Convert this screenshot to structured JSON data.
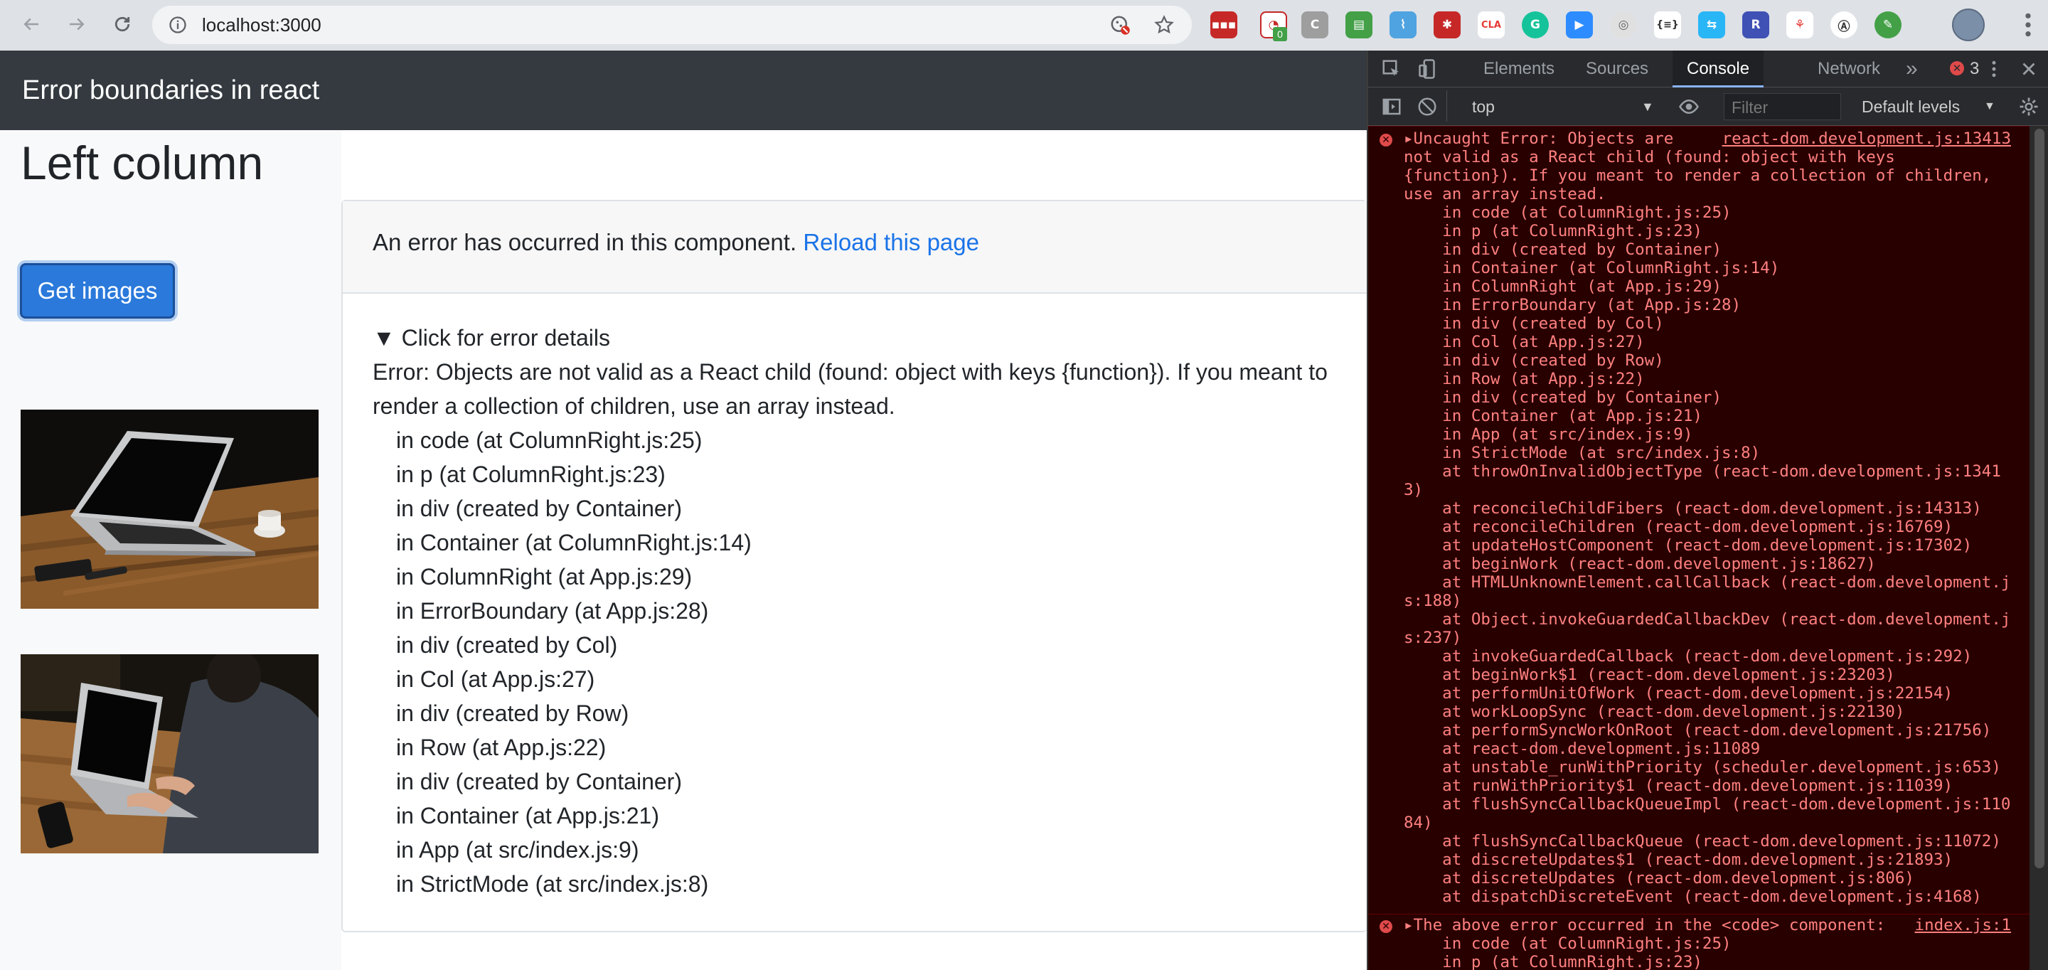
{
  "browser": {
    "url": "localhost:3000",
    "extension_badge": "0"
  },
  "app": {
    "title": "Error boundaries in react"
  },
  "left_column": {
    "heading": "Left column",
    "button_label": "Get images"
  },
  "error_card": {
    "header_text": "An error has occurred in this component.",
    "reload_link": "Reload this page",
    "summary": "▼ Click for error details",
    "error_message": "Error: Objects are not valid as a React child (found: object with keys {function}). If you meant to render a collection of children, use an array instead.",
    "stack": [
      "in code (at ColumnRight.js:25)",
      "in p (at ColumnRight.js:23)",
      "in div (created by Container)",
      "in Container (at ColumnRight.js:14)",
      "in ColumnRight (at App.js:29)",
      "in ErrorBoundary (at App.js:28)",
      "in div (created by Col)",
      "in Col (at App.js:27)",
      "in div (created by Row)",
      "in Row (at App.js:22)",
      "in div (created by Container)",
      "in Container (at App.js:21)",
      "in App (at src/index.js:9)",
      "in StrictMode (at src/index.js:8)"
    ]
  },
  "devtools": {
    "tabs": [
      "Elements",
      "Sources",
      "Console",
      "Network"
    ],
    "active_tab": "Console",
    "more_tabs": "»",
    "error_count": "3",
    "context": "top",
    "filter_placeholder": "Filter",
    "levels": "Default levels",
    "colors": {
      "error_text": "#ff8080",
      "error_bg": "#290000"
    },
    "messages": [
      {
        "source": "react-dom.development.js:13413",
        "lines": [
          "▸Uncaught Error: Objects are",
          "not valid as a React child (found: object with keys",
          "{function}). If you meant to render a collection of children,",
          "use an array instead.",
          "    in code (at ColumnRight.js:25)",
          "    in p (at ColumnRight.js:23)",
          "    in div (created by Container)",
          "    in Container (at ColumnRight.js:14)",
          "    in ColumnRight (at App.js:29)",
          "    in ErrorBoundary (at App.js:28)",
          "    in div (created by Col)",
          "    in Col (at App.js:27)",
          "    in div (created by Row)",
          "    in Row (at App.js:22)",
          "    in div (created by Container)",
          "    in Container (at App.js:21)",
          "    in App (at src/index.js:9)",
          "    in StrictMode (at src/index.js:8)",
          "    at throwOnInvalidObjectType (react-dom.development.js:1341",
          "3)",
          "    at reconcileChildFibers (react-dom.development.js:14313)",
          "    at reconcileChildren (react-dom.development.js:16769)",
          "    at updateHostComponent (react-dom.development.js:17302)",
          "    at beginWork (react-dom.development.js:18627)",
          "    at HTMLUnknownElement.callCallback (react-dom.development.j",
          "s:188)",
          "    at Object.invokeGuardedCallbackDev (react-dom.development.j",
          "s:237)",
          "    at invokeGuardedCallback (react-dom.development.js:292)",
          "    at beginWork$1 (react-dom.development.js:23203)",
          "    at performUnitOfWork (react-dom.development.js:22154)",
          "    at workLoopSync (react-dom.development.js:22130)",
          "    at performSyncWorkOnRoot (react-dom.development.js:21756)",
          "    at react-dom.development.js:11089",
          "    at unstable_runWithPriority (scheduler.development.js:653)",
          "    at runWithPriority$1 (react-dom.development.js:11039)",
          "    at flushSyncCallbackQueueImpl (react-dom.development.js:110",
          "84)",
          "    at flushSyncCallbackQueue (react-dom.development.js:11072)",
          "    at discreteUpdates$1 (react-dom.development.js:21893)",
          "    at discreteUpdates (react-dom.development.js:806)",
          "    at dispatchDiscreteEvent (react-dom.development.js:4168)"
        ]
      },
      {
        "source": "index.js:1",
        "lines": [
          "▸The above error occurred in the <code> component:",
          "    in code (at ColumnRight.js:25)",
          "    in p (at ColumnRight.js:23)"
        ]
      }
    ]
  }
}
